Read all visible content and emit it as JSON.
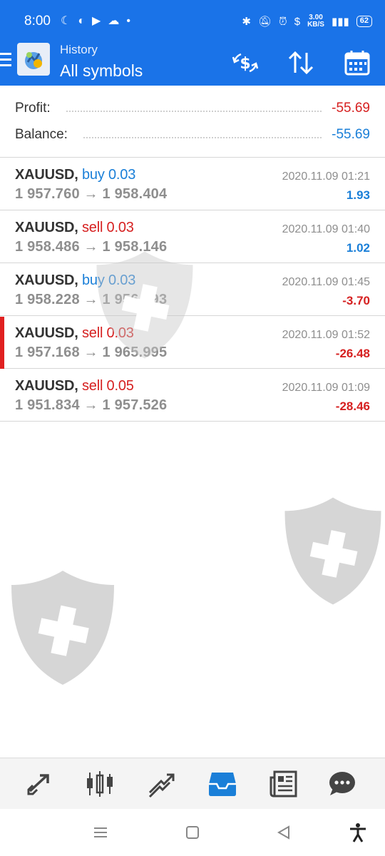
{
  "status_bar": {
    "time": "8:00",
    "speed_value": "3.00",
    "speed_unit": "KB/S",
    "battery": "62"
  },
  "toolbar": {
    "subtitle": "History",
    "title": "All symbols",
    "actions": [
      "exchange-dollar-icon",
      "sort-icon",
      "calendar-icon"
    ]
  },
  "summary": {
    "profit_label": "Profit:",
    "profit_value": "-55.69",
    "balance_label": "Balance:",
    "balance_value": "-55.69"
  },
  "deals": [
    {
      "symbol": "XAUUSD,",
      "side": "buy 0.03",
      "open": "1 957.760",
      "close": "1 958.404",
      "time": "2020.11.09 01:21",
      "profit": "1.93",
      "selected": false
    },
    {
      "symbol": "XAUUSD,",
      "side": "sell 0.03",
      "open": "1 958.486",
      "close": "1 958.146",
      "time": "2020.11.09 01:40",
      "profit": "1.02",
      "selected": false
    },
    {
      "symbol": "XAUUSD,",
      "side": "buy 0.03",
      "open": "1 958.228",
      "close": "1 956.993",
      "time": "2020.11.09 01:45",
      "profit": "-3.70",
      "selected": false
    },
    {
      "symbol": "XAUUSD,",
      "side": "sell 0.03",
      "open": "1 957.168",
      "close": "1 965.995",
      "time": "2020.11.09 01:52",
      "profit": "-26.48",
      "selected": true
    },
    {
      "symbol": "XAUUSD,",
      "side": "sell 0.05",
      "open": "1 951.834",
      "close": "1 957.526",
      "time": "2020.11.09 01:09",
      "profit": "-28.46",
      "selected": false
    }
  ],
  "arrow": "→",
  "bottom_nav": [
    "quotes",
    "chart",
    "trade",
    "history",
    "news",
    "messages"
  ],
  "active_tab": "history",
  "colors": {
    "brand": "#1a73e8",
    "buy": "#1a7fd8",
    "sell": "#d62020",
    "muted": "#8e8e8e"
  }
}
